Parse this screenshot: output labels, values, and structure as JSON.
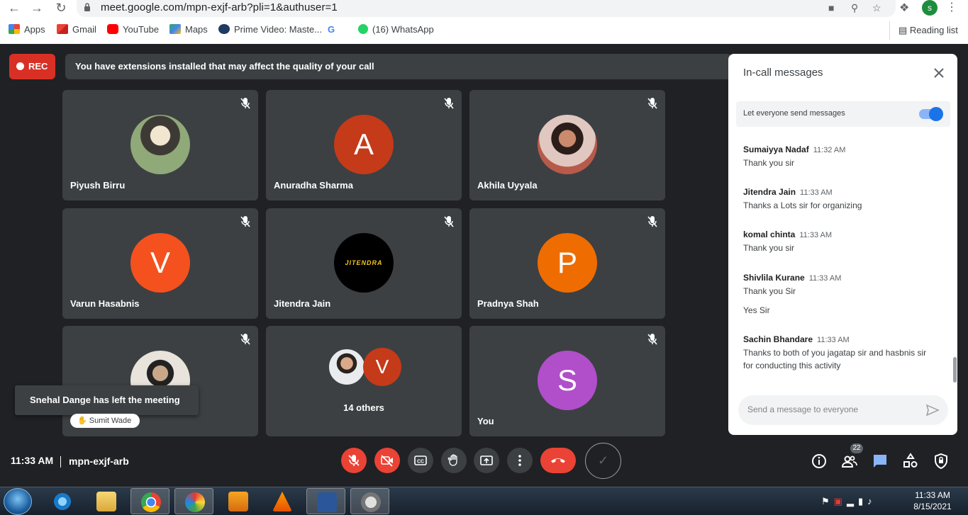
{
  "browser": {
    "url": "meet.google.com/mpn-exjf-arb?pli=1&authuser=1",
    "profile_initial": "s",
    "bookmarks": [
      {
        "label": "Apps",
        "icon": "apps-grid-icon"
      },
      {
        "label": "Gmail",
        "icon": "gmail-icon"
      },
      {
        "label": "YouTube",
        "icon": "youtube-icon"
      },
      {
        "label": "Maps",
        "icon": "maps-icon"
      },
      {
        "label": "Prime Video: Maste...",
        "icon": "prime-video-icon"
      },
      {
        "label": "",
        "icon": "google-icon"
      },
      {
        "label": "(16) WhatsApp",
        "icon": "whatsapp-icon"
      }
    ],
    "reading_list": "Reading list"
  },
  "meet": {
    "rec_label": "REC",
    "warning": "You have extensions installed that may affect the quality of your call",
    "tiles": [
      {
        "name": "Piyush Birru",
        "initial": "",
        "color": "#7a8f6a"
      },
      {
        "name": "Anuradha Sharma",
        "initial": "A",
        "color": "#c53a19"
      },
      {
        "name": "Akhila Uyyala",
        "initial": "",
        "color": "#c88a7a"
      },
      {
        "name": "Varun Hasabnis",
        "initial": "V",
        "color": "#f4511e"
      },
      {
        "name": "Jitendra Jain",
        "initial": "",
        "color": "#000000"
      },
      {
        "name": "Pradnya Shah",
        "initial": "P",
        "color": "#ef6c00"
      },
      {
        "name": "",
        "initial": "",
        "color": "#d9d4c8"
      },
      {
        "name": "14 others",
        "initial": "V",
        "color": "#c53a19"
      },
      {
        "name": "You",
        "initial": "S",
        "color": "#b04fc9"
      }
    ],
    "jitendra_logo": "JITENDRA",
    "toast": "Snehal Dange has left the meeting",
    "hand_raise": "Sumit Wade",
    "time": "11:33 AM",
    "code": "mpn-exjf-arb",
    "participants_count": "22"
  },
  "chat": {
    "title": "In-call messages",
    "toggle_label": "Let everyone send messages",
    "messages": [
      {
        "sender": "Sumaiyya Nadaf",
        "time": "11:32 AM",
        "text": "Thank you sir"
      },
      {
        "sender": "Jitendra Jain",
        "time": "11:33 AM",
        "text": "Thanks a Lots sir for organizing"
      },
      {
        "sender": "komal chinta",
        "time": "11:33 AM",
        "text": "Thank you sir"
      },
      {
        "sender": "Shivlila Kurane",
        "time": "11:33 AM",
        "text": "Thank you Sir",
        "extra": "Yes Sir"
      },
      {
        "sender": "Sachin Bhandare",
        "time": "11:33 AM",
        "text": "Thanks to both of you jagatap sir and hasbnis sir for conducting this activity"
      }
    ],
    "placeholder": "Send a message to everyone"
  },
  "taskbar": {
    "time": "11:33 AM",
    "date": "8/15/2021"
  }
}
